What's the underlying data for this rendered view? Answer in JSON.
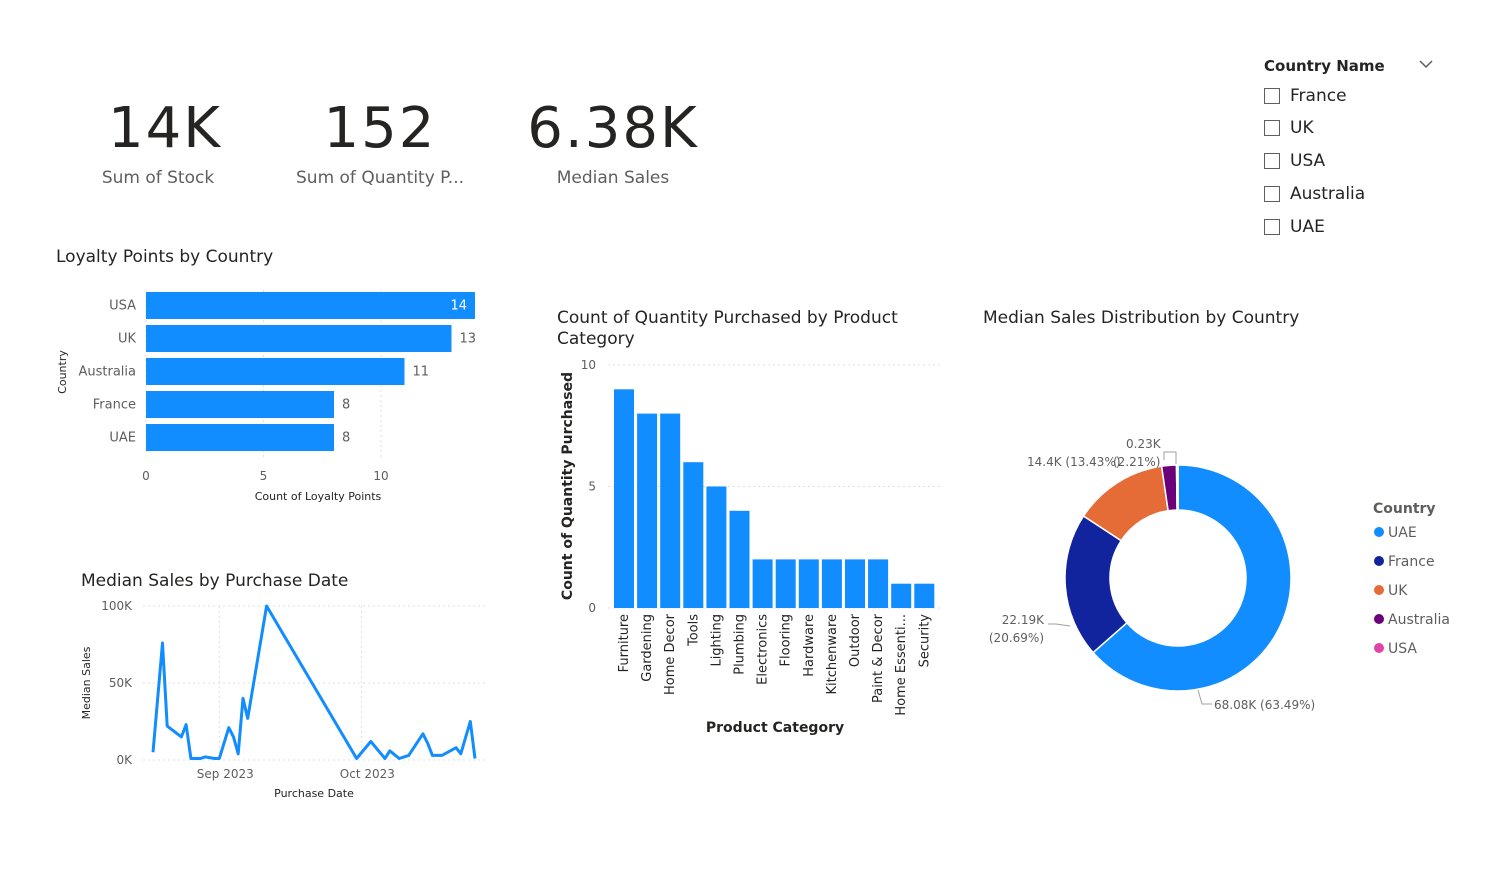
{
  "kpis": [
    {
      "value": "14K",
      "label": "Sum of  Stock"
    },
    {
      "value": "152",
      "label": "Sum of Quantity P..."
    },
    {
      "value": "6.38K",
      "label": "Median Sales"
    }
  ],
  "slicer": {
    "title": "Country Name",
    "items": [
      "France",
      "UK",
      "USA",
      "Australia",
      "UAE"
    ]
  },
  "colors": {
    "bar_blue": "#118DFF",
    "line_blue": "#118DFF",
    "uae": "#118DFF",
    "france": "#12239E",
    "uk": "#E66C37",
    "australia": "#6B007B",
    "usa": "#E044A7"
  },
  "chart_data": [
    {
      "id": "loyalty",
      "type": "bar",
      "orientation": "horizontal",
      "title": "Loyalty Points by Country",
      "xlabel": "Count of Loyalty Points",
      "ylabel": "Country",
      "categories": [
        "USA",
        "UK",
        "Australia",
        "France",
        "UAE"
      ],
      "values": [
        14,
        13,
        11,
        8,
        8
      ],
      "xlim": [
        0,
        14
      ],
      "xticks": [
        0,
        5,
        10
      ],
      "grid": true
    },
    {
      "id": "median_sales_date",
      "type": "line",
      "title": "Median Sales by Purchase Date",
      "xlabel": "Purchase Date",
      "ylabel": "Median Sales",
      "x_tick_labels": [
        "Sep 2023",
        "Oct 2023"
      ],
      "y_tick_labels": [
        "100K",
        "50K",
        "0K"
      ],
      "ylim": [
        0,
        100000
      ],
      "x": [
        "2023-08-18",
        "2023-08-20",
        "2023-08-21",
        "2023-08-24",
        "2023-08-25",
        "2023-08-26",
        "2023-08-28",
        "2023-08-29",
        "2023-08-31",
        "2023-09-01",
        "2023-09-03",
        "2023-09-04",
        "2023-09-05",
        "2023-09-06",
        "2023-09-07",
        "2023-09-11",
        "2023-09-30",
        "2023-10-03",
        "2023-10-06",
        "2023-10-07",
        "2023-10-09",
        "2023-10-11",
        "2023-10-14",
        "2023-10-15",
        "2023-10-16",
        "2023-10-18",
        "2023-10-21",
        "2023-10-22",
        "2023-10-24",
        "2023-10-25"
      ],
      "values": [
        5000,
        76000,
        22000,
        15000,
        23000,
        1000,
        1000,
        2000,
        1000,
        1000,
        21000,
        15000,
        4000,
        40000,
        27000,
        100000,
        1000,
        12000,
        1000,
        6000,
        1000,
        3000,
        17000,
        11000,
        3000,
        3000,
        8000,
        4000,
        25000,
        1000
      ],
      "grid": true
    },
    {
      "id": "quantity_category",
      "type": "bar",
      "orientation": "vertical",
      "title": "Count of Quantity Purchased by Product Category",
      "xlabel": "Product Category",
      "ylabel": "Count of Quantity Purchased",
      "categories": [
        "Furniture",
        "Gardening",
        "Home Decor",
        "Tools",
        "Lighting",
        "Plumbing",
        "Electronics",
        "Flooring",
        "Hardware",
        "Kitchenware",
        "Outdoor",
        "Paint & Decor",
        "Home Essenti...",
        "Security"
      ],
      "values": [
        9,
        8,
        8,
        6,
        5,
        4,
        2,
        2,
        2,
        2,
        2,
        2,
        1,
        1
      ],
      "ylim": [
        0,
        10
      ],
      "yticks": [
        0,
        5,
        10
      ],
      "grid": true
    },
    {
      "id": "median_sales_country",
      "type": "pie",
      "donut": true,
      "title": "Median Sales Distribution by Country",
      "legend_title": "Country",
      "legend_position": "right",
      "categories": [
        "UAE",
        "France",
        "UK",
        "Australia",
        "USA"
      ],
      "values": [
        68080,
        22190,
        14400,
        2250,
        230
      ],
      "data_labels": [
        "68.08K (63.49%)",
        "22.19K (20.69%)",
        "14.4K (13.43%)",
        "(2.21%)",
        "0.23K"
      ]
    }
  ]
}
